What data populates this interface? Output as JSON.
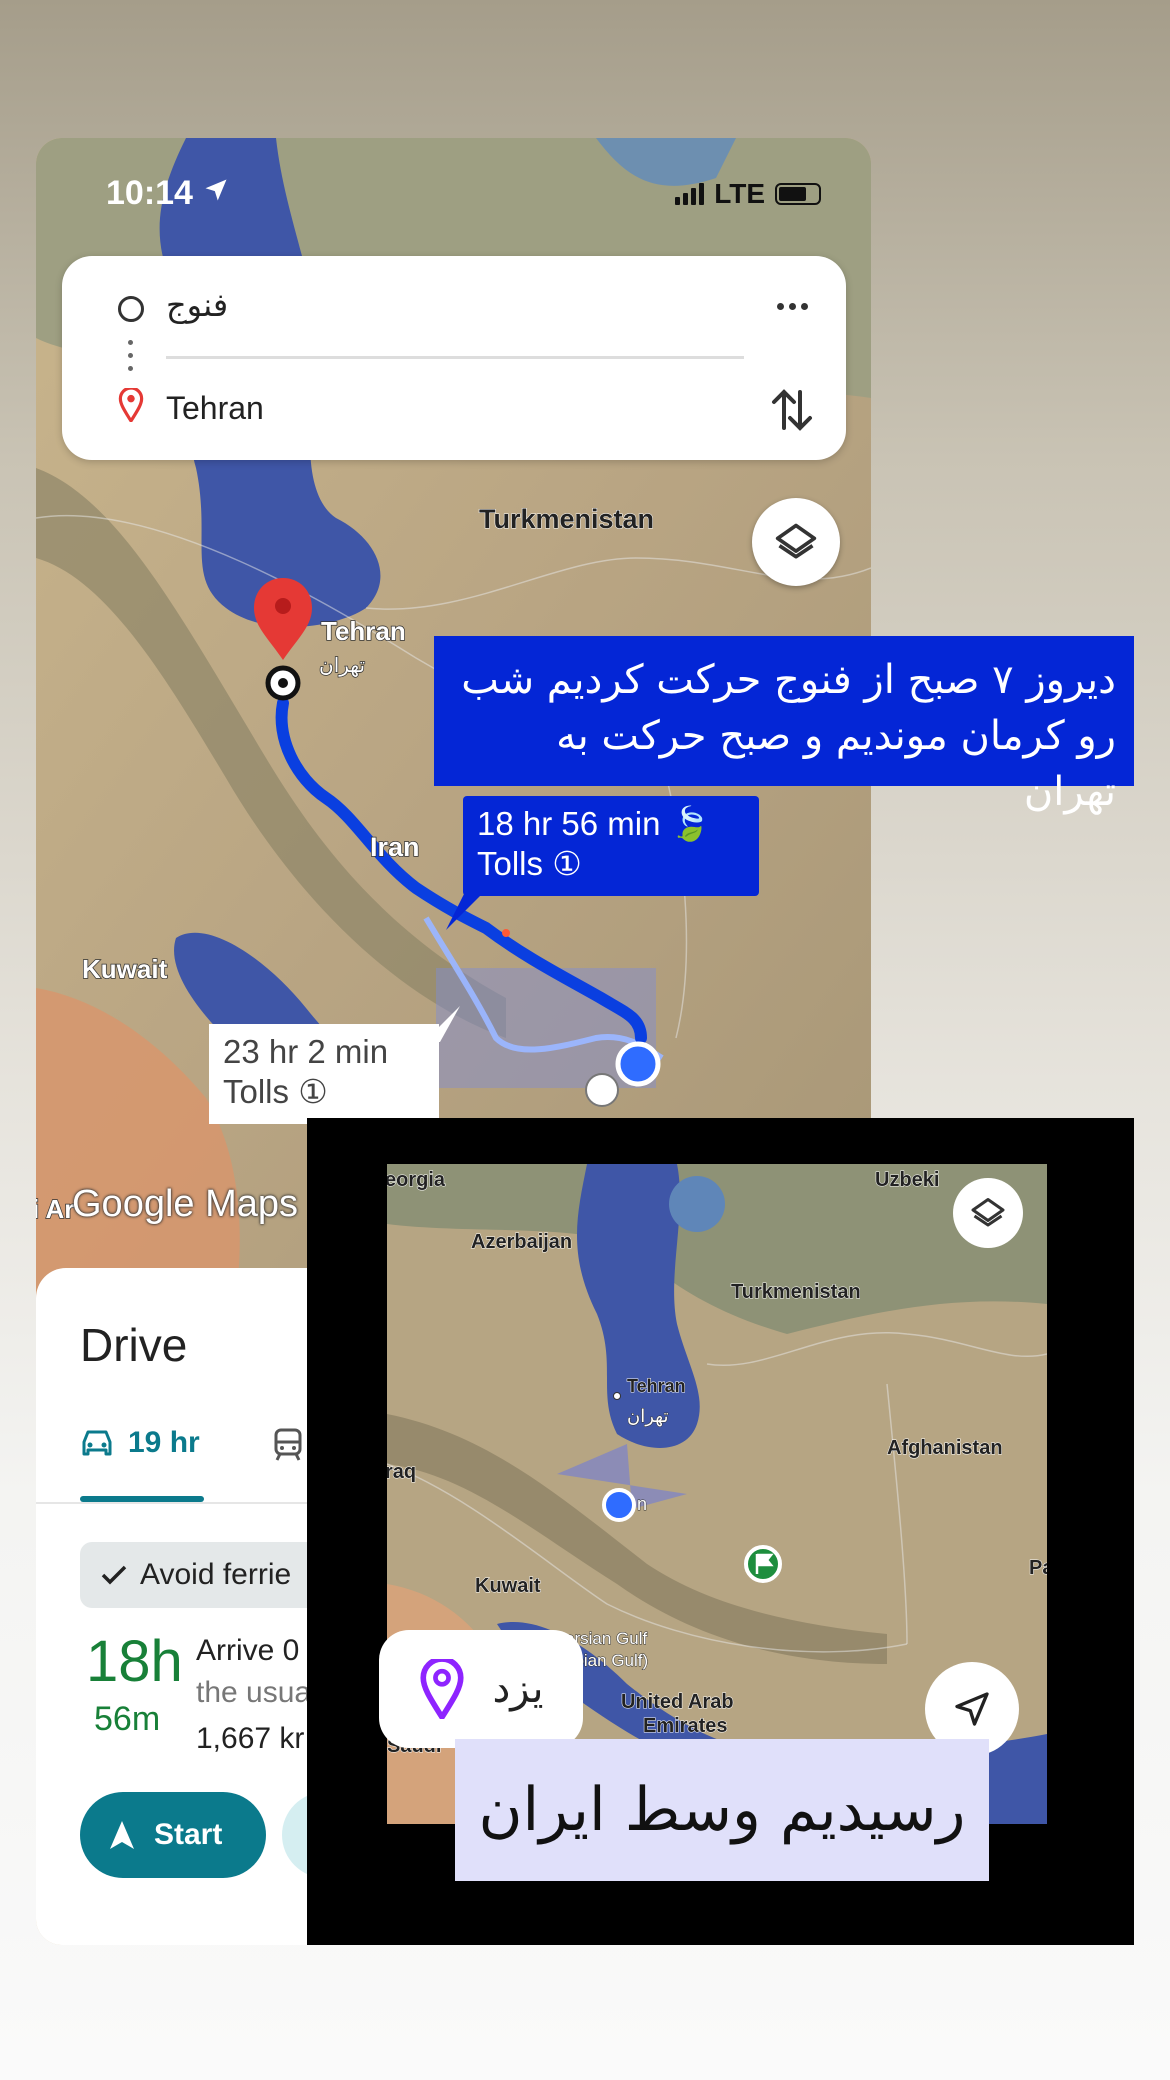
{
  "status_bar": {
    "time": "10:14",
    "network": "LTE"
  },
  "directions": {
    "origin": "فنوج",
    "destination": "Tehran"
  },
  "map1": {
    "labels": {
      "turkmenistan": "Turkmenistan",
      "tehran": "Tehran",
      "tehran_fa": "تهران",
      "iran": "Iran",
      "kuwait": "Kuwait",
      "arabia": "i Ar",
      "logo": "Google Maps"
    },
    "route_main": {
      "time": "18 hr 56 min",
      "tolls": "Tolls"
    },
    "route_alt": {
      "time": "23 hr 2 min",
      "tolls": "Tolls"
    }
  },
  "sheet": {
    "title": "Drive",
    "tab_drive": "19 hr",
    "chip": "Avoid ferrie",
    "duration_hours": "18h",
    "duration_minutes": "56m",
    "arrive": "Arrive 0",
    "usual": "the usua",
    "distance": "1,667 kr",
    "start": "Start"
  },
  "caption1": {
    "line1": "دیروز ۷ صبح از فنوج حرکت کردیم شب",
    "line2": "رو کرمان موندیم و صبح حرکت به تهران"
  },
  "map2": {
    "labels": {
      "georgia": "eorgia",
      "uzbek": "Uzbeki",
      "azerbaijan": "Azerbaijan",
      "turkmenistan": "Turkmenistan",
      "tehran": "Tehran",
      "tehran_fa": "تهران",
      "afghanistan": "Afghanistan",
      "iraq": "raq",
      "kuwait": "Kuwait",
      "gulf1": "ersian Gulf",
      "gulf2": "abian Gulf)",
      "uae1": "United Arab",
      "uae2": "Emirates",
      "saudi": "Saudi",
      "pak": "Pa",
      "yazd_partial": "n"
    },
    "location_pill": "یزد"
  },
  "caption2": "رسیدیم وسط ایران",
  "colors": {
    "route_blue": "#0426d6",
    "teal": "#0b7a8c",
    "green": "#188038",
    "purple_pin": "#8e24ff"
  }
}
